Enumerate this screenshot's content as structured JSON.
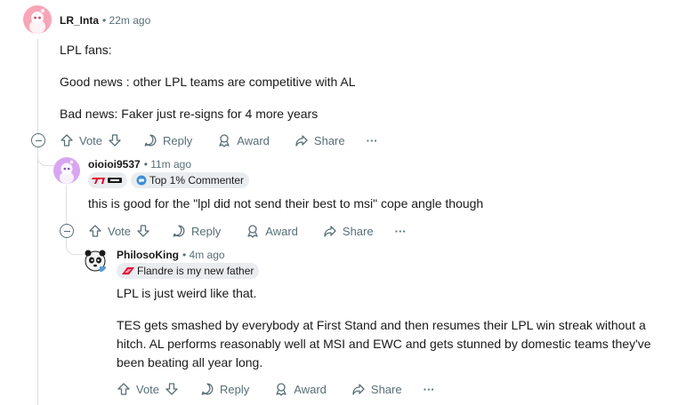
{
  "comments": [
    {
      "username": "LR_Inta",
      "time": "• 22m ago",
      "paragraphs": [
        "LPL fans:",
        "Good news : other LPL teams are competitive with AL",
        "Bad news: Faker just re-signs for 4 more years"
      ]
    },
    {
      "username": "oioioi9537",
      "time": "• 11m ago",
      "flair_badge": "Top 1% Commenter",
      "paragraphs": [
        "this is good for the \"lpl did not send their best to msi\" cope angle though"
      ]
    },
    {
      "username": "PhilosoKing",
      "time": "• 4m ago",
      "flair": "Flandre is my new father",
      "paragraphs": [
        "LPL is just weird like that.",
        "TES gets smashed by everybody at First Stand and then resumes their LPL win streak without a hitch. AL performs reasonably well at MSI and EWC and gets stunned by domestic teams they've been beating all year long."
      ]
    }
  ],
  "actions": {
    "vote": "Vote",
    "reply": "Reply",
    "award": "Award",
    "share": "Share",
    "more": "···"
  },
  "colors": {
    "accent_avatar1": "#f8a5b8",
    "accent_avatar2": "#d8a6f0",
    "meta": "#576f76",
    "thread_line": "#dadfe2"
  }
}
